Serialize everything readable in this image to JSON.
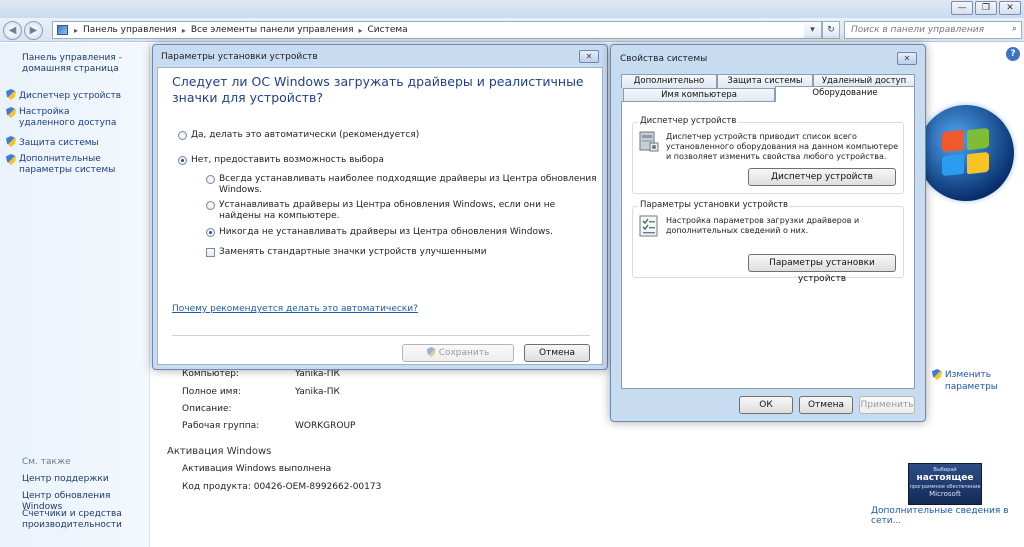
{
  "window": {
    "minimize": "—",
    "maximize": "❐",
    "close": "✕"
  },
  "nav": {
    "back": "◀",
    "forward": "▶",
    "breadcrumb": [
      "Панель управления",
      "Все элементы панели управления",
      "Система"
    ],
    "breadcrumb_sep": "▸",
    "dropdown": "▾",
    "refresh": "↻",
    "search_placeholder": "Поиск в панели управления",
    "search_icon": "⌕"
  },
  "sidebar": {
    "home_link": "Панель управления - домашняя страница",
    "items": [
      {
        "label": "Диспетчер устройств",
        "icon": "shield-icon"
      },
      {
        "label": "Настройка удаленного доступа",
        "icon": "shield-icon"
      },
      {
        "label": "Защита системы",
        "icon": "shield-icon"
      },
      {
        "label": "Дополнительные параметры системы",
        "icon": "shield-icon"
      }
    ],
    "see_also": "См. также",
    "see_also_items": [
      "Центр поддержки",
      "Центр обновления Windows",
      "Счетчики и средства производительности"
    ]
  },
  "main": {
    "computer_label": "Компьютер:",
    "computer_value": "Yanika-ПК",
    "fullname_label": "Полное имя:",
    "fullname_value": "Yanika-ПК",
    "description_label": "Описание:",
    "workgroup_label": "Рабочая группа:",
    "workgroup_value": "WORKGROUP",
    "activation_title": "Активация Windows",
    "activation_status": "Активация Windows выполнена",
    "product_code": "Код продукта: 00426-OEM-8992662-00173",
    "change_params": "Изменить параметры",
    "genuine_line1": "Выбирай",
    "genuine_line2": "настоящее",
    "genuine_line3": "программное обеспечение",
    "genuine_line4": "Microsoft",
    "more_info": "Дополнительные сведения в сети...",
    "help": "?"
  },
  "install_dialog": {
    "title": "Параметры установки устройств",
    "close": "✕",
    "question": "Следует ли ОС Windows загружать драйверы и реалистичные значки для устройств?",
    "option_auto": "Да, делать это автоматически (рекомендуется)",
    "option_choose": "Нет, предоставить возможность выбора",
    "sub_always": "Всегда устанавливать наиболее подходящие драйверы из Центра обновления Windows.",
    "sub_if_not_found": "Устанавливать драйверы из Центра обновления Windows, если они не найдены на компьютере.",
    "sub_never": "Никогда не устанавливать драйверы из Центра обновления Windows.",
    "replace_icons": "Заменять стандартные значки устройств улучшенными",
    "why_link": "Почему рекомендуется делать это автоматически?",
    "save": "Сохранить",
    "cancel": "Отмена"
  },
  "sysprops_dialog": {
    "title": "Свойства системы",
    "close": "✕",
    "tabs_top": [
      "Дополнительно",
      "Защита системы",
      "Удаленный доступ"
    ],
    "tabs_bottom": [
      "Имя компьютера",
      "Оборудование"
    ],
    "devmgr_group": "Диспетчер устройств",
    "devmgr_text": "Диспетчер устройств приводит список всего установленного оборудования на данном компьютере и позволяет изменить свойства любого устройства.",
    "devmgr_button": "Диспетчер устройств",
    "install_group": "Параметры установки устройств",
    "install_text": "Настройка параметров загрузки драйверов и дополнительных сведений о них.",
    "install_button": "Параметры установки устройств",
    "ok": "ОК",
    "cancel": "Отмена",
    "apply": "Применить"
  }
}
